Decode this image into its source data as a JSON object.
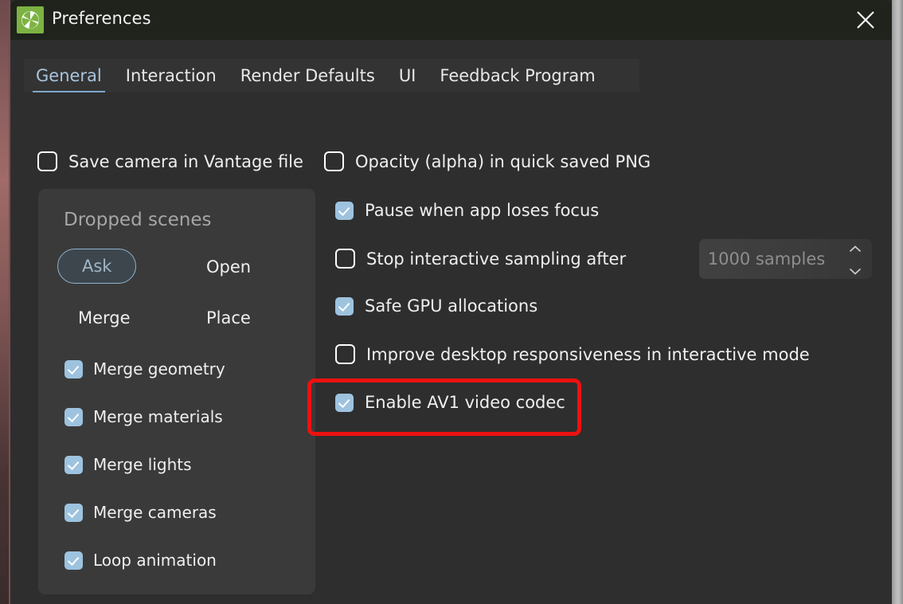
{
  "window": {
    "title": "Preferences",
    "app_icon": "chaos-vantage-logo-icon",
    "close_icon": "close-icon"
  },
  "tabs": [
    {
      "label": "General",
      "active": true
    },
    {
      "label": "Interaction",
      "active": false
    },
    {
      "label": "Render Defaults",
      "active": false
    },
    {
      "label": "UI",
      "active": false
    },
    {
      "label": "Feedback Program",
      "active": false
    }
  ],
  "top_options": [
    {
      "label": "Save camera in Vantage file",
      "checked": false
    },
    {
      "label": "Opacity (alpha) in quick saved PNG",
      "checked": false
    }
  ],
  "dropped_scenes": {
    "title": "Dropped scenes",
    "options": [
      {
        "label": "Ask",
        "selected": true
      },
      {
        "label": "Open",
        "selected": false
      },
      {
        "label": "Merge",
        "selected": false
      },
      {
        "label": "Place",
        "selected": false
      }
    ],
    "checkboxes": [
      {
        "label": "Merge geometry",
        "checked": true
      },
      {
        "label": "Merge materials",
        "checked": true
      },
      {
        "label": "Merge lights",
        "checked": true
      },
      {
        "label": "Merge cameras",
        "checked": true
      },
      {
        "label": "Loop animation",
        "checked": true
      }
    ]
  },
  "right_options": [
    {
      "label": "Pause when app loses focus",
      "checked": true
    },
    {
      "label": "Stop interactive sampling after",
      "checked": false
    },
    {
      "label": "Safe GPU allocations",
      "checked": true
    },
    {
      "label": "Improve desktop responsiveness in interactive mode",
      "checked": false
    },
    {
      "label": "Enable AV1 video codec",
      "checked": true
    }
  ],
  "samples_spinner": {
    "value": "1000 samples",
    "increment_icon": "chevron-up-icon",
    "decrement_icon": "chevron-down-icon"
  },
  "annotation": {
    "target_label": "Enable AV1 video codec",
    "color": "#ee1111"
  },
  "colors": {
    "window_background": "#2e2e2e",
    "titlebar_background": "#1f231c",
    "group_background": "#3a3a3a",
    "accent_checkbox": "#9dc3df",
    "accent_tab": "#7fa7ca",
    "app_icon_green": "#7cb342"
  }
}
